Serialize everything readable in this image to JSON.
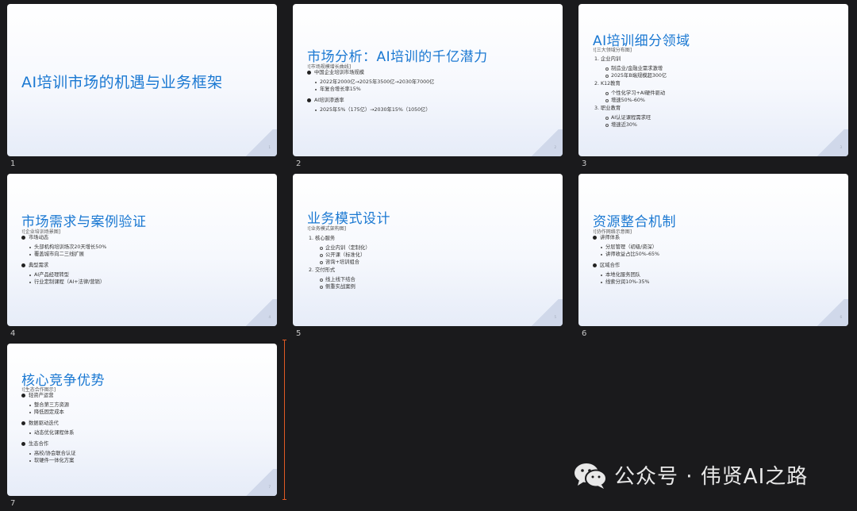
{
  "slides": [
    {
      "num": "1",
      "page": "1",
      "title": "AI培训市场的机遇与业务框架"
    },
    {
      "num": "2",
      "page": "2",
      "title": "市场分析：AI培训的千亿潜力",
      "subtitle": "![市场规模增长曲线]",
      "items": [
        {
          "text": "中国企业培训市场规模",
          "children": [
            "2022年2000亿→2025年3500亿→2030年7000亿",
            "年复合增长率15%"
          ]
        },
        {
          "text": "AI培训渗透率",
          "children": [
            "2025年5%（175亿）→2030年15%（1050亿）"
          ]
        }
      ]
    },
    {
      "num": "3",
      "page": "3",
      "title": "AI培训细分领域",
      "subtitle": "![三大领域分布图]",
      "items": [
        {
          "text": "1. 企业内训",
          "children": [
            "制造业/金融业需求激增",
            "2025年B端规模超300亿"
          ]
        },
        {
          "text": "2. K12教育",
          "children": [
            "个性化学习+AI硬件驱动",
            "增速50%-60%"
          ]
        },
        {
          "text": "3. 职业教育",
          "children": [
            "AI认证课程需求旺",
            "增速近30%"
          ]
        }
      ]
    },
    {
      "num": "4",
      "page": "4",
      "title": "市场需求与案例验证",
      "subtitle": "![企业培训场景图]",
      "items": [
        {
          "text": "市场动态",
          "children": [
            "头部机构培训场次20天增长50%",
            "覆盖城市向二三线扩展"
          ]
        },
        {
          "text": "典型需求",
          "children": [
            "AI产品经理转型",
            "行业定制课程（AI+法律/营销）"
          ]
        }
      ]
    },
    {
      "num": "5",
      "page": "5",
      "title": "业务模式设计",
      "subtitle": "![业务模式架构图]",
      "items": [
        {
          "text": "1. 核心服务",
          "children": [
            "企业内训（定制化）",
            "公开课（标准化）",
            "咨询+培训组合"
          ]
        },
        {
          "text": "2. 交付形式",
          "children": [
            "线上线下结合",
            "侧重实战案例"
          ]
        }
      ]
    },
    {
      "num": "6",
      "page": "6",
      "title": "资源整合机制",
      "subtitle": "![协作网络示意图]",
      "items": [
        {
          "text": "讲师体系",
          "children": [
            "分层管理（初级/资深）",
            "讲师收益占比50%-65%"
          ]
        },
        {
          "text": "区域合作",
          "children": [
            "本地化服务团队",
            "线索分润10%-35%"
          ]
        }
      ]
    },
    {
      "num": "7",
      "page": "7",
      "title": "核心竞争优势",
      "subtitle": "![生态合作图示]",
      "items": [
        {
          "text": "轻资产运营",
          "children": [
            "整合第三方资源",
            "降低固定成本"
          ]
        },
        {
          "text": "数据驱动迭代",
          "children": [
            "动态优化课程体系"
          ]
        },
        {
          "text": "生态合作",
          "children": [
            "高校/协会联合认证",
            "软硬件一体化方案"
          ]
        }
      ]
    }
  ],
  "watermark": {
    "text": "公众号 · 伟贤AI之路",
    "icon": "wechat-icon"
  },
  "colors": {
    "title": "#1a78d2",
    "background": "#1a1a1c",
    "cursor": "#e05a24"
  }
}
